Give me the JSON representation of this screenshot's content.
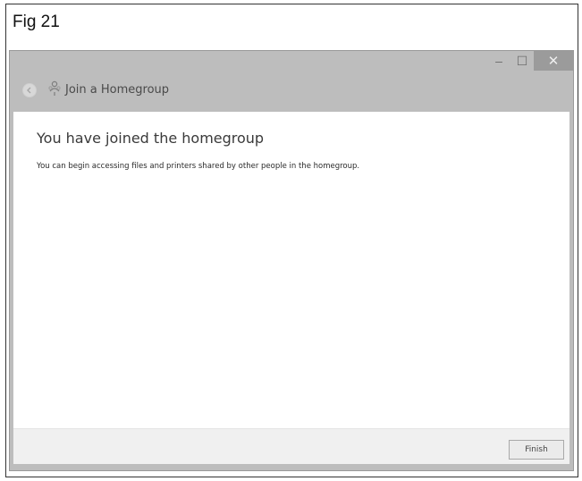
{
  "figure": {
    "label": "Fig 21"
  },
  "window": {
    "title": "Join a Homegroup",
    "controls": {
      "minimize": "–",
      "maximize": "☐",
      "close": "✕"
    }
  },
  "content": {
    "heading": "You have joined the homegroup",
    "description": "You can begin accessing files and printers shared by other people in the homegroup."
  },
  "footer": {
    "finish_label": "Finish"
  },
  "icons": {
    "back": "back-arrow-icon",
    "homegroup": "homegroup-icon"
  }
}
